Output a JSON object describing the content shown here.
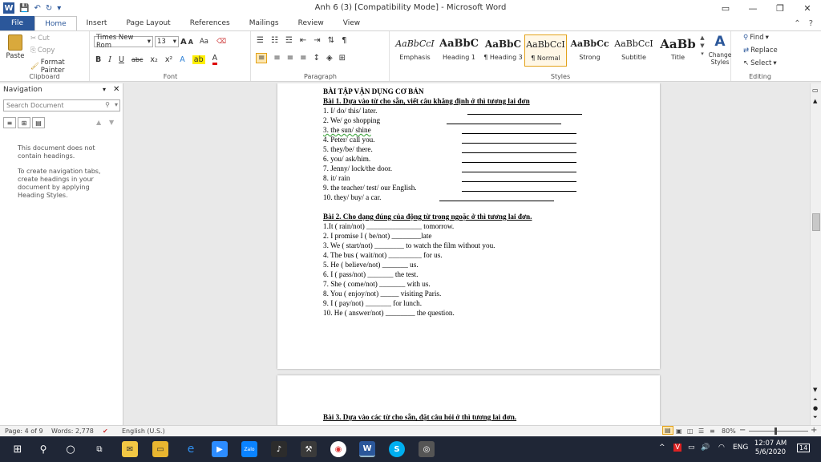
{
  "window": {
    "title": "Anh 6 (3) [Compatibility Mode]  -  Microsoft Word",
    "logo_letter": "W",
    "controls": {
      "minimize": "—",
      "restore": "❐",
      "close": "✕"
    },
    "help_icons": {
      "options": "▭",
      "help": "?"
    }
  },
  "tabs": [
    "File",
    "Home",
    "Insert",
    "Page Layout",
    "References",
    "Mailings",
    "Review",
    "View"
  ],
  "ribbon": {
    "clipboard": {
      "paste": "Paste",
      "cut": "Cut",
      "copy": "Copy",
      "format_painter": "Format Painter",
      "label": "Clipboard"
    },
    "font": {
      "name": "Times New Rom",
      "size": "13",
      "bold": "B",
      "italic": "I",
      "underline": "U",
      "strike": "abc",
      "sub": "x₂",
      "sup": "x²",
      "grow": "A",
      "shrink": "A",
      "case": "Aa",
      "label": "Font"
    },
    "paragraph": {
      "label": "Paragraph",
      "pilcrow": "¶"
    },
    "styles": {
      "label": "Styles",
      "items": [
        {
          "preview": "AaBbCcI",
          "name": "Emphasis"
        },
        {
          "preview": "AaBbC",
          "name": "Heading 1"
        },
        {
          "preview": "AaBbC",
          "name": "¶ Heading 3"
        },
        {
          "preview": "AaBbCcI",
          "name": "¶ Normal"
        },
        {
          "preview": "AaBbCc",
          "name": "Strong"
        },
        {
          "preview": "AaBbCcI",
          "name": "Subtitle"
        },
        {
          "preview": "AaBb",
          "name": "Title"
        }
      ],
      "change_styles": "Change Styles"
    },
    "editing": {
      "find": "Find",
      "replace": "Replace",
      "select": "Select",
      "label": "Editing"
    }
  },
  "nav": {
    "title": "Navigation",
    "search_placeholder": "Search Document",
    "msg1": "This document does not contain headings.",
    "msg2": "To create navigation tabs, create headings in your document by applying Heading Styles."
  },
  "document": {
    "heading": "BÀI TẬP VẬN DỤNG CƠ BẢN",
    "ex1_title": "Bài 1. Dựa vào từ cho sẵn, viết câu khẳng định ở thì tương lai đơn",
    "ex1_lines": [
      "1. I/ do/ this/ later.",
      "2. We/ go shopping",
      "3. the sun/ shine",
      "4. Peter/ call you.",
      "5. they/be/ there.",
      "6. you/ ask/him.",
      "7. Jenny/ lock/the door.",
      "8. it/ rain",
      "9. the teacher/ test/ our English.",
      "10. they/ buy/ a car."
    ],
    "ex2_title": "Bài 2. Cho dạng đúng của động từ trong ngoặc ở thì tương lai đơn.",
    "ex2_lines": [
      "1.It ( rain/not) _______________ tomorrow.",
      "2. I  promise I ( be/not) ________late",
      "3. We ( start/not) ________ to watch the film without you.",
      "4. The bus ( wait/not) _________ for us.",
      "5. He ( believe/not) _______ us.",
      "6. I ( pass/not) _______ the test.",
      "7. She ( come/not) _______ with us.",
      "8. You ( enjoy/not) _____ visiting Paris.",
      "9. I ( pay/not) _______ for lunch.",
      "10. He ( answer/not) ________ the question."
    ],
    "ex3_title": "Bài 3. Dựa vào các từ cho sẵn, đặt câu hỏi ở thì tương lai đơn."
  },
  "status": {
    "page": "Page: 4 of 9",
    "words": "Words: 2,778",
    "language": "English (U.S.)",
    "zoom": "80%",
    "zoom_minus": "−",
    "zoom_plus": "+"
  },
  "taskbar": {
    "language": "ENG",
    "time": "12:07 AM",
    "date": "5/6/2020",
    "notifications": "14",
    "app_letters": {
      "word": "W",
      "skype": "S",
      "zalo": "Zalo"
    }
  }
}
